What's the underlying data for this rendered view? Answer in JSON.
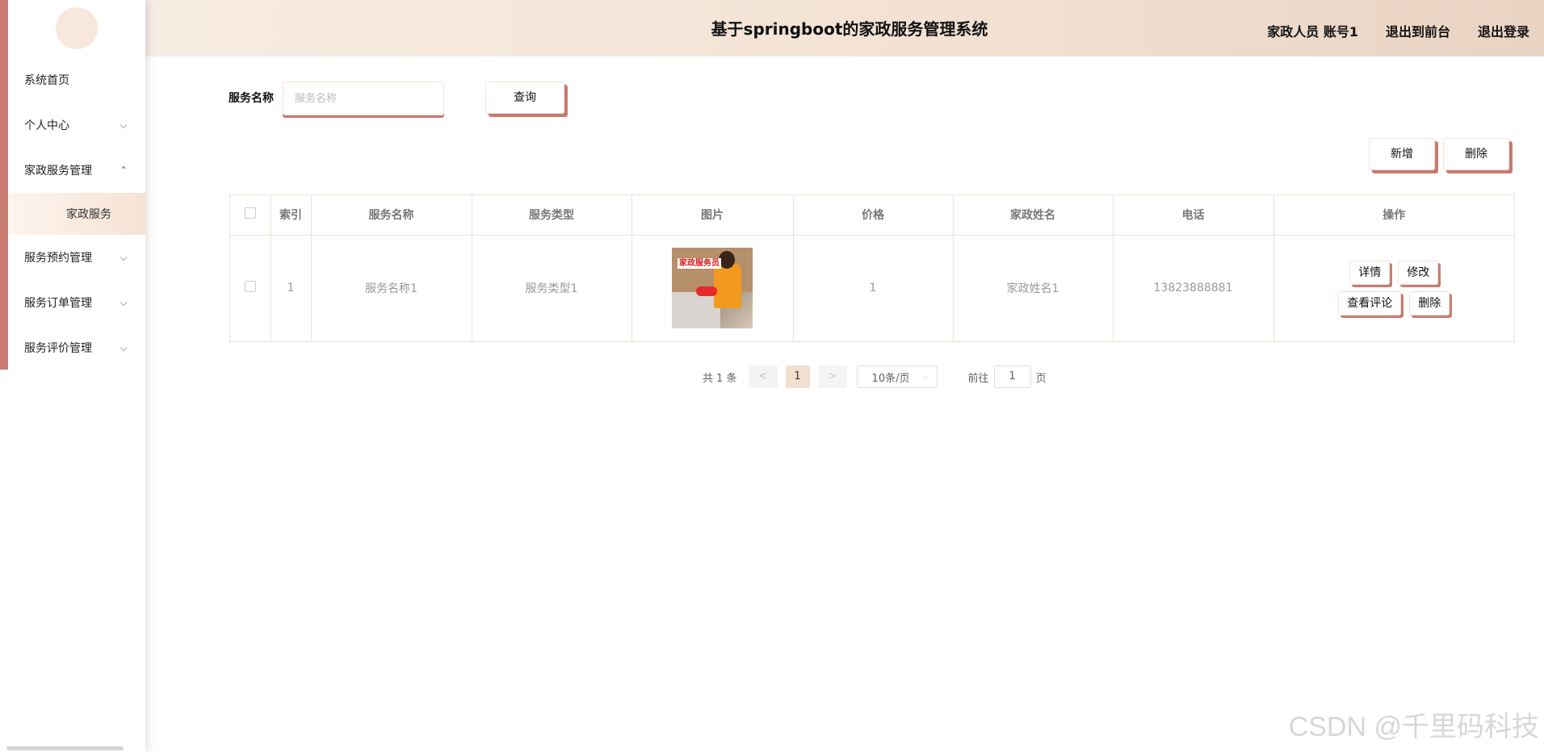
{
  "header": {
    "title": "基于springboot的家政服务管理系统",
    "user": "家政人员 账号1",
    "to_front": "退出到前台",
    "logout": "退出登录"
  },
  "sidebar": {
    "items": [
      {
        "label": "系统首页"
      },
      {
        "label": "个人中心"
      },
      {
        "label": "家政服务管理"
      },
      {
        "label": "服务预约管理"
      },
      {
        "label": "服务订单管理"
      },
      {
        "label": "服务评价管理"
      }
    ],
    "sub_active": "家政服务"
  },
  "search": {
    "label": "服务名称",
    "placeholder": "服务名称",
    "query_button": "查询"
  },
  "actions": {
    "add": "新增",
    "delete": "删除"
  },
  "table": {
    "headers": [
      "索引",
      "服务名称",
      "服务类型",
      "图片",
      "价格",
      "家政姓名",
      "电话",
      "操作"
    ],
    "rows": [
      {
        "index": "1",
        "name": "服务名称1",
        "type": "服务类型1",
        "image_tag": "家政服务员",
        "price": "1",
        "worker": "家政姓名1",
        "phone": "13823888881",
        "ops": {
          "detail": "详情",
          "edit": "修改",
          "reviews": "查看评论",
          "delete": "删除"
        }
      }
    ]
  },
  "pagination": {
    "total": "共 1 条",
    "prev": "<",
    "current": "1",
    "next": ">",
    "page_size": "10条/页",
    "goto_label": "前往",
    "goto_value": "1",
    "page_unit": "页"
  },
  "watermark": "CSDN @千里码科技"
}
